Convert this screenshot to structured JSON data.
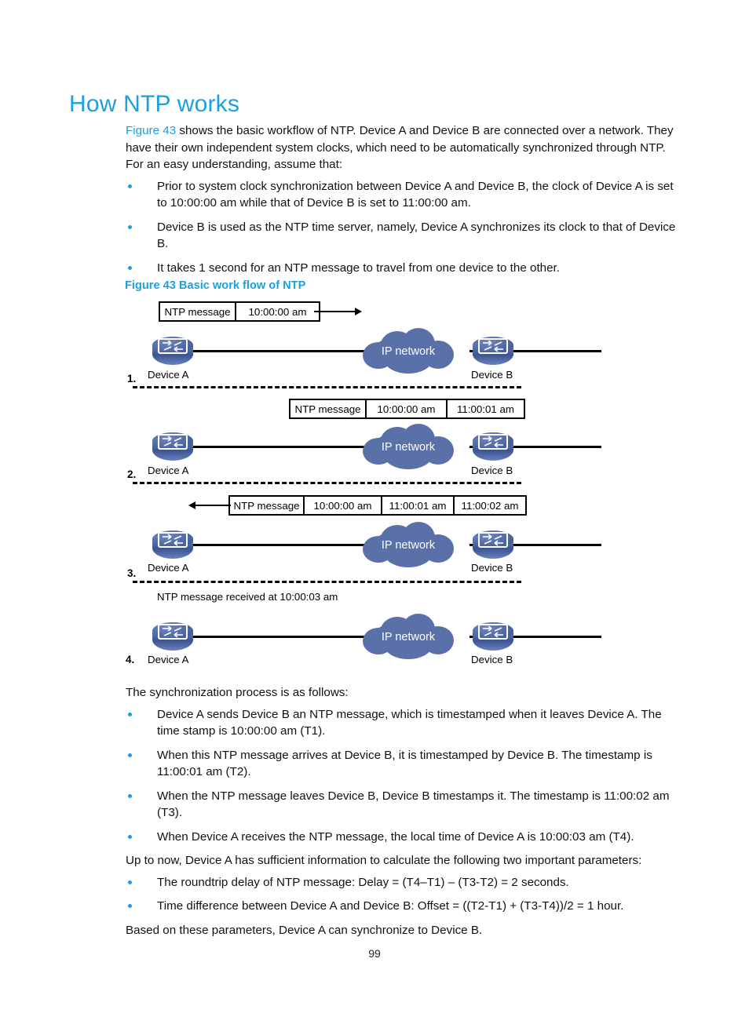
{
  "page": {
    "title": "How NTP works",
    "page_number": "99"
  },
  "intro": {
    "link_text": "Figure 43",
    "rest": " shows the basic workflow of NTP. Device A and Device B are connected over a network. They have their own independent system clocks, which need to be automatically synchronized through NTP. For an easy understanding, assume that:"
  },
  "assumptions": [
    "Prior to system clock synchronization between Device A and Device B, the clock of Device A is set to 10:00:00 am while that of Device B is set to 11:00:00 am.",
    "Device B is used as the NTP time server, namely, Device A synchronizes its clock to that of Device B.",
    "It takes 1 second for an NTP message to travel from one device to the other."
  ],
  "figure": {
    "caption": "Figure 43 Basic work flow of NTP",
    "cloud_label": "IP network",
    "device_a_label": "Device A",
    "device_b_label": "Device B",
    "steps": [
      {
        "number": "1.",
        "box_cells": [
          "NTP message",
          "10:00:00 am"
        ],
        "arrow_direction": "right",
        "note": ""
      },
      {
        "number": "2.",
        "box_cells": [
          "NTP message",
          "10:00:00 am",
          "11:00:01 am"
        ],
        "arrow_direction": "none",
        "note": ""
      },
      {
        "number": "3.",
        "box_cells": [
          "NTP message",
          "10:00:00 am",
          "11:00:01 am",
          "11:00:02 am"
        ],
        "arrow_direction": "left",
        "note": ""
      },
      {
        "number": "4.",
        "box_cells": [],
        "arrow_direction": "none",
        "note": "NTP message received at 10:00:03 am"
      }
    ]
  },
  "process": {
    "lead_in": "The synchronization process is as follows:",
    "steps": [
      "Device A sends Device B an NTP message, which is timestamped when it leaves Device A. The time stamp is 10:00:00 am (T1).",
      "When this NTP message arrives at Device B, it is timestamped by Device B. The timestamp is 11:00:01 am (T2).",
      "When the NTP message leaves Device B, Device B timestamps it. The timestamp is 11:00:02 am (T3).",
      "When Device A receives the NTP message, the local time of Device A is 10:00:03 am (T4)."
    ]
  },
  "parameters": {
    "lead_in": "Up to now, Device A has sufficient information to calculate the following two important parameters:",
    "items": [
      "The roundtrip delay of NTP message: Delay = (T4–T1) – (T3-T2) = 2 seconds.",
      "Time difference between Device A and Device B: Offset = ((T2-T1) + (T3-T4))/2 = 1 hour."
    ],
    "conclusion": "Based on these parameters, Device A can synchronize to Device B."
  },
  "colors": {
    "heading": "#1a9fe0",
    "link": "#1a9fe0",
    "bullet": "#1a9fe0",
    "cloud": "#5a70a8",
    "router": "#48609e"
  }
}
